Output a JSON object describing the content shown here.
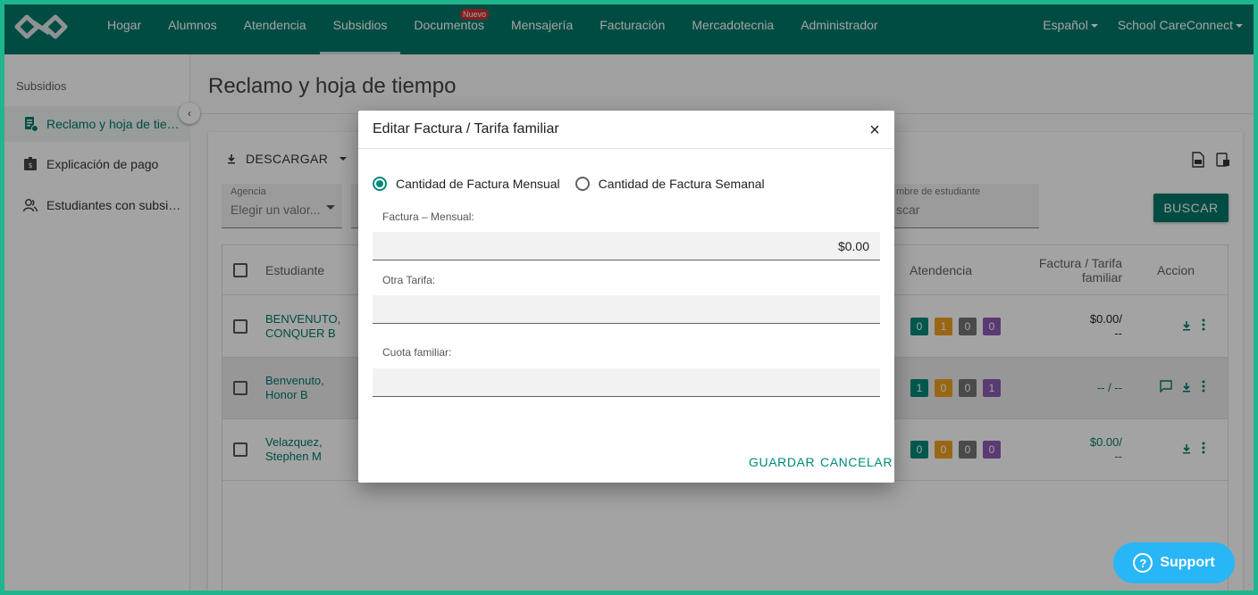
{
  "nav": {
    "items": [
      {
        "label": "Hogar"
      },
      {
        "label": "Alumnos"
      },
      {
        "label": "Atendencia"
      },
      {
        "label": "Subsidios"
      },
      {
        "label": "Documentos",
        "badge": "Nuevo"
      },
      {
        "label": "Mensajería"
      },
      {
        "label": "Facturación"
      },
      {
        "label": "Mercadotecnia"
      },
      {
        "label": "Administrador"
      }
    ],
    "active": "Subsidios",
    "language": "Español",
    "account": "School CareConnect"
  },
  "sidebar": {
    "title": "Subsidios",
    "items": [
      {
        "label": "Reclamo y hoja de tiempo",
        "icon": "document-list-icon"
      },
      {
        "label": "Explicación de pago",
        "icon": "bank-icon"
      },
      {
        "label": "Estudiantes con subsidio",
        "icon": "people-icon"
      }
    ]
  },
  "main": {
    "title": "Reclamo y hoja de tiempo",
    "download_label": "DESCARGAR",
    "filters": {
      "agency_label": "Agencia",
      "agency_value": "Elegir un valor...",
      "student_label": "mbre de estudiante",
      "student_value": "scar"
    },
    "search_label": "BUSCAR",
    "table": {
      "headers": {
        "student": "Estudiante",
        "attendance": "Atendencia",
        "invoice_line1": "Factura / Tarifa",
        "invoice_line2": "familiar",
        "action": "Accion"
      },
      "rows": [
        {
          "name_line1": "BENVENUTO,",
          "name_line2": "CONQUER B",
          "badges": [
            "0",
            "1",
            "0",
            "0"
          ],
          "amount_line1": "$0.00/",
          "amount_line2": "--",
          "amount_color": "#212121",
          "comment": false
        },
        {
          "name_line1": "Benvenuto,",
          "name_line2": "Honor B",
          "badges": [
            "1",
            "0",
            "0",
            "1"
          ],
          "amount_line1": "-- / --",
          "amount_line2": "",
          "amount_color": "#00796b",
          "comment": true
        },
        {
          "name_line1": "Velazquez,",
          "name_line2": "Stephen M",
          "badges": [
            "0",
            "0",
            "0",
            "0"
          ],
          "amount_line1": "$0.00/",
          "amount_line2": "--",
          "amount_color": "#00796b",
          "comment": false
        }
      ],
      "badge_colors": [
        "#00897b",
        "#f0a21f",
        "#757575",
        "#8e5bb5"
      ]
    }
  },
  "dialog": {
    "title": "Editar Factura / Tarifa familiar",
    "radio_monthly": "Cantidad de Factura Mensual",
    "radio_weekly": "Cantidad de Factura Semanal",
    "selected": "monthly",
    "monthly_label": "Factura – Mensual:",
    "monthly_value": "$0.00",
    "other_label": "Otra Tarifa:",
    "other_value": "",
    "family_label": "Cuota familiar:",
    "family_value": "",
    "save_label": "GUARDAR",
    "cancel_label": "CANCELAR"
  },
  "support_label": "Support"
}
